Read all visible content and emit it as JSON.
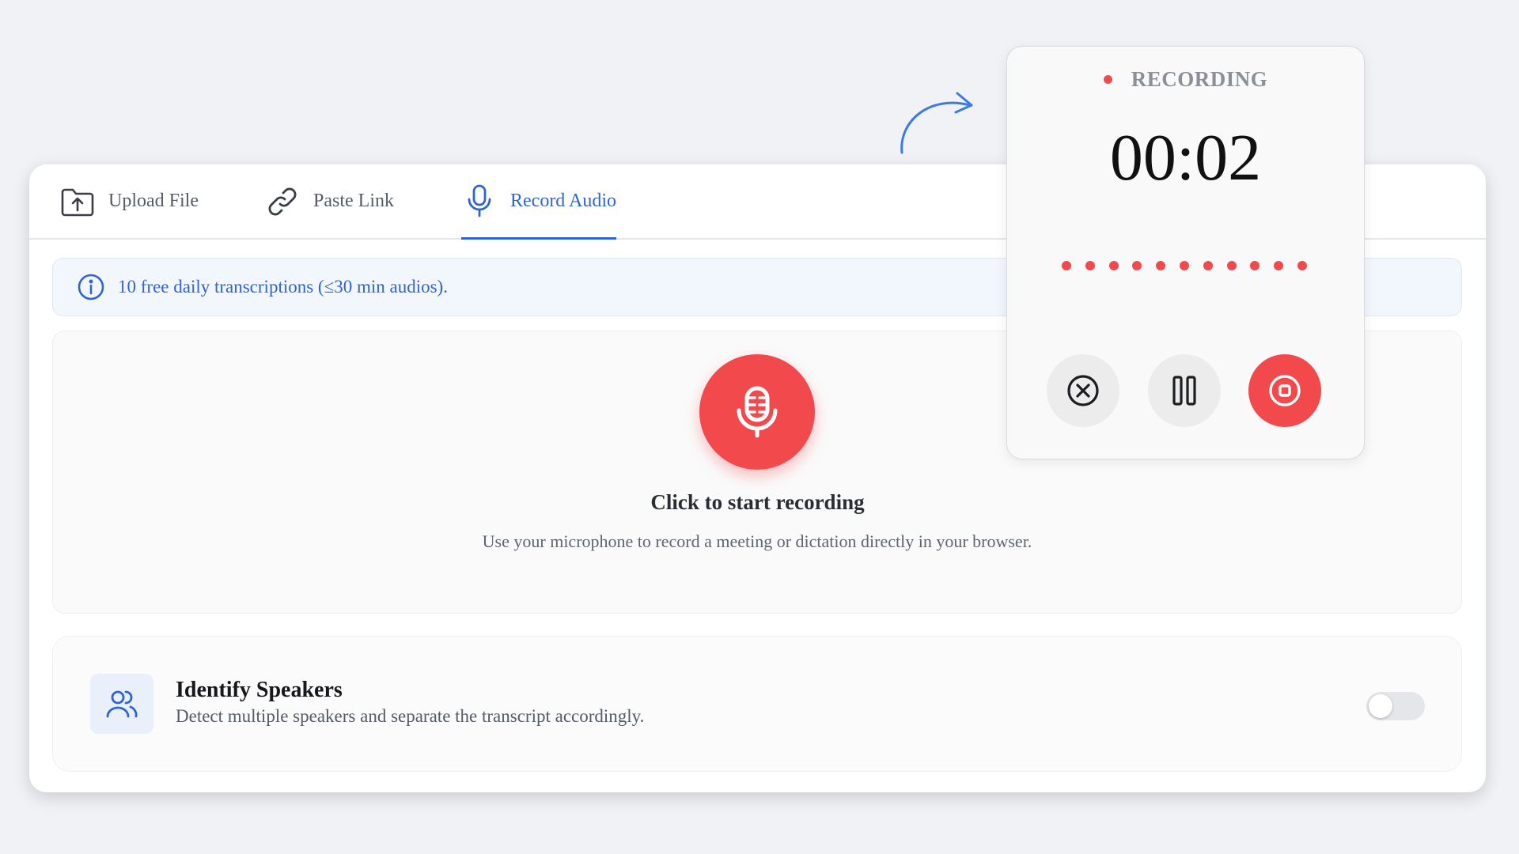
{
  "tabs": {
    "upload": {
      "label": "Upload File",
      "icon": "folder-upload-icon"
    },
    "paste": {
      "label": "Paste Link",
      "icon": "link-icon"
    },
    "record": {
      "label": "Record Audio",
      "icon": "microphone-icon",
      "active": true
    }
  },
  "info_banner": {
    "icon": "info-icon",
    "text": "10 free daily transcriptions (≤30 min audios)."
  },
  "record_panel": {
    "mic_icon": "microphone-icon",
    "title": "Click to start recording",
    "description": "Use your microphone to record a meeting or dictation directly in your browser."
  },
  "speakers": {
    "icon": "users-icon",
    "title": "Identify Speakers",
    "description": "Detect multiple speakers and separate the transcript accordingly.",
    "enabled": false
  },
  "recording_widget": {
    "status": "RECORDING",
    "timer": "00:02",
    "level_dot_count": 11,
    "controls": {
      "cancel_icon": "close-circle-icon",
      "pause_icon": "pause-icon",
      "stop_icon": "stop-circle-icon"
    }
  },
  "colors": {
    "accent_blue": "#2e64d6",
    "record_red": "#f2494c",
    "background": "#f1f2f6"
  }
}
